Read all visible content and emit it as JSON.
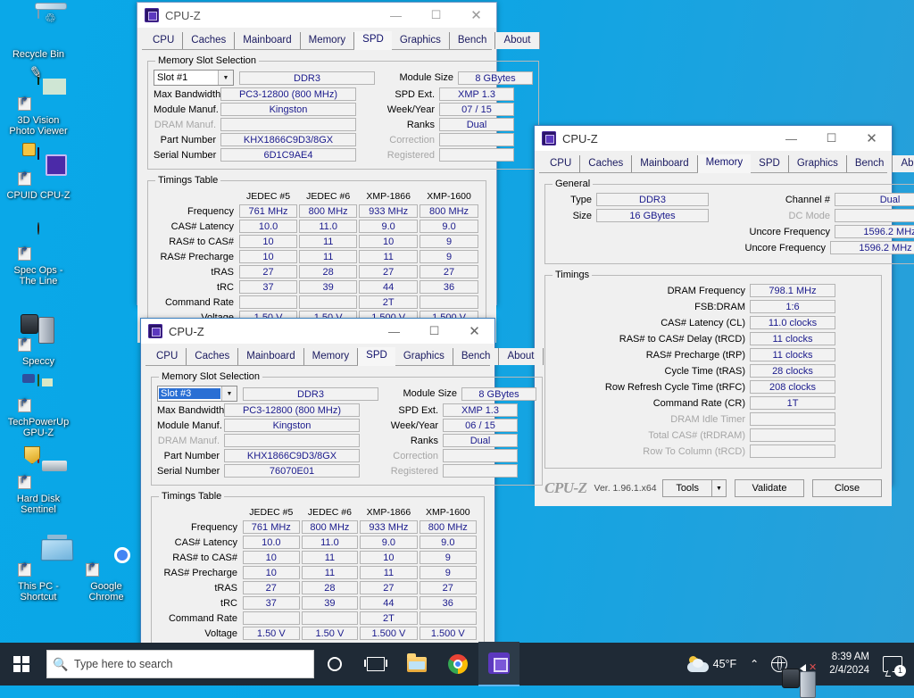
{
  "desktop": {
    "icons": [
      {
        "name": "recycle-bin",
        "label": "Recycle Bin"
      },
      {
        "name": "3d-vision-photo-viewer",
        "label": "3D Vision\nPhoto Viewer"
      },
      {
        "name": "cpuid-cpu-z",
        "label": "CPUID CPU-Z"
      },
      {
        "name": "spec-ops-the-line",
        "label": "Spec Ops -\nThe Line"
      },
      {
        "name": "speccy",
        "label": "Speccy"
      },
      {
        "name": "techpowerup-gpu-z",
        "label": "TechPowerUp\nGPU-Z"
      },
      {
        "name": "hard-disk-sentinel",
        "label": "Hard Disk\nSentinel"
      },
      {
        "name": "this-pc-shortcut",
        "label": "This PC -\nShortcut"
      },
      {
        "name": "google-chrome",
        "label": "Google\nChrome"
      }
    ]
  },
  "common": {
    "app_title": "CPU-Z",
    "tabs": [
      "CPU",
      "Caches",
      "Mainboard",
      "Memory",
      "SPD",
      "Graphics",
      "Bench",
      "About"
    ],
    "minimize": "—",
    "maximize": "☐",
    "close": "✕"
  },
  "spd_window_1": {
    "title": "CPU-Z",
    "selected_tab": "SPD",
    "slot_group_title": "Memory Slot Selection",
    "slot_selected": "Slot #1",
    "slot_focused": false,
    "memory_type": "DDR3",
    "left_fields": [
      {
        "label": "Max Bandwidth",
        "value": "PC3-12800 (800 MHz)",
        "dim": false
      },
      {
        "label": "Module Manuf.",
        "value": "Kingston",
        "dim": false
      },
      {
        "label": "DRAM Manuf.",
        "value": "",
        "dim": true
      },
      {
        "label": "Part Number",
        "value": "KHX1866C9D3/8GX",
        "dim": false
      },
      {
        "label": "Serial Number",
        "value": "6D1C9AE4",
        "dim": false
      }
    ],
    "right_fields": [
      {
        "label": "Module Size",
        "value": "8 GBytes",
        "dim": false
      },
      {
        "label": "SPD Ext.",
        "value": "XMP 1.3",
        "dim": false
      },
      {
        "label": "Week/Year",
        "value": "07 / 15",
        "dim": false
      },
      {
        "label": "Ranks",
        "value": "Dual",
        "dim": false
      },
      {
        "label": "Correction",
        "value": "",
        "dim": true
      },
      {
        "label": "Registered",
        "value": "",
        "dim": true
      }
    ],
    "timings_title": "Timings Table",
    "timings_columns": [
      "JEDEC #5",
      "JEDEC #6",
      "XMP-1866",
      "XMP-1600"
    ],
    "timings_rows": [
      {
        "label": "Frequency",
        "values": [
          "761 MHz",
          "800 MHz",
          "933 MHz",
          "800 MHz"
        ]
      },
      {
        "label": "CAS# Latency",
        "values": [
          "10.0",
          "11.0",
          "9.0",
          "9.0"
        ]
      },
      {
        "label": "RAS# to CAS#",
        "values": [
          "10",
          "11",
          "10",
          "9"
        ]
      },
      {
        "label": "RAS# Precharge",
        "values": [
          "10",
          "11",
          "11",
          "9"
        ]
      },
      {
        "label": "tRAS",
        "values": [
          "27",
          "28",
          "27",
          "27"
        ]
      },
      {
        "label": "tRC",
        "values": [
          "37",
          "39",
          "44",
          "36"
        ]
      },
      {
        "label": "Command Rate",
        "values": [
          "",
          "",
          "2T",
          ""
        ]
      },
      {
        "label": "Voltage",
        "values": [
          "1.50 V",
          "1.50 V",
          "1.500 V",
          "1.500 V"
        ]
      }
    ]
  },
  "spd_window_2": {
    "title": "CPU-Z",
    "selected_tab": "SPD",
    "slot_group_title": "Memory Slot Selection",
    "slot_selected": "Slot #3",
    "slot_focused": true,
    "memory_type": "DDR3",
    "left_fields": [
      {
        "label": "Max Bandwidth",
        "value": "PC3-12800 (800 MHz)",
        "dim": false
      },
      {
        "label": "Module Manuf.",
        "value": "Kingston",
        "dim": false
      },
      {
        "label": "DRAM Manuf.",
        "value": "",
        "dim": true
      },
      {
        "label": "Part Number",
        "value": "KHX1866C9D3/8GX",
        "dim": false
      },
      {
        "label": "Serial Number",
        "value": "76070E01",
        "dim": false
      }
    ],
    "right_fields": [
      {
        "label": "Module Size",
        "value": "8 GBytes",
        "dim": false
      },
      {
        "label": "SPD Ext.",
        "value": "XMP 1.3",
        "dim": false
      },
      {
        "label": "Week/Year",
        "value": "06 / 15",
        "dim": false
      },
      {
        "label": "Ranks",
        "value": "Dual",
        "dim": false
      },
      {
        "label": "Correction",
        "value": "",
        "dim": true
      },
      {
        "label": "Registered",
        "value": "",
        "dim": true
      }
    ],
    "timings_title": "Timings Table",
    "timings_columns": [
      "JEDEC #5",
      "JEDEC #6",
      "XMP-1866",
      "XMP-1600"
    ],
    "timings_rows": [
      {
        "label": "Frequency",
        "values": [
          "761 MHz",
          "800 MHz",
          "933 MHz",
          "800 MHz"
        ]
      },
      {
        "label": "CAS# Latency",
        "values": [
          "10.0",
          "11.0",
          "9.0",
          "9.0"
        ]
      },
      {
        "label": "RAS# to CAS#",
        "values": [
          "10",
          "11",
          "10",
          "9"
        ]
      },
      {
        "label": "RAS# Precharge",
        "values": [
          "10",
          "11",
          "11",
          "9"
        ]
      },
      {
        "label": "tRAS",
        "values": [
          "27",
          "28",
          "27",
          "27"
        ]
      },
      {
        "label": "tRC",
        "values": [
          "37",
          "39",
          "44",
          "36"
        ]
      },
      {
        "label": "Command Rate",
        "values": [
          "",
          "",
          "2T",
          ""
        ]
      },
      {
        "label": "Voltage",
        "values": [
          "1.50 V",
          "1.50 V",
          "1.500 V",
          "1.500 V"
        ]
      }
    ]
  },
  "memory_window": {
    "title": "CPU-Z",
    "selected_tab": "Memory",
    "general_title": "General",
    "general_left": [
      {
        "label": "Type",
        "value": "DDR3",
        "dim": false
      },
      {
        "label": "Size",
        "value": "16 GBytes",
        "dim": false
      }
    ],
    "general_right": [
      {
        "label": "Channel #",
        "value": "Dual",
        "dim": false
      },
      {
        "label": "DC Mode",
        "value": "",
        "dim": true
      },
      {
        "label": "Uncore Frequency",
        "value": "1596.2 MHz",
        "dim": false
      }
    ],
    "timings_title": "Timings",
    "timings": [
      {
        "label": "DRAM Frequency",
        "value": "798.1 MHz",
        "dim": false
      },
      {
        "label": "FSB:DRAM",
        "value": "1:6",
        "dim": false
      },
      {
        "label": "CAS# Latency (CL)",
        "value": "11.0 clocks",
        "dim": false
      },
      {
        "label": "RAS# to CAS# Delay (tRCD)",
        "value": "11 clocks",
        "dim": false
      },
      {
        "label": "RAS# Precharge (tRP)",
        "value": "11 clocks",
        "dim": false
      },
      {
        "label": "Cycle Time (tRAS)",
        "value": "28 clocks",
        "dim": false
      },
      {
        "label": "Row Refresh Cycle Time (tRFC)",
        "value": "208 clocks",
        "dim": false
      },
      {
        "label": "Command Rate (CR)",
        "value": "1T",
        "dim": false
      },
      {
        "label": "DRAM Idle Timer",
        "value": "",
        "dim": true
      },
      {
        "label": "Total CAS# (tRDRAM)",
        "value": "",
        "dim": true
      },
      {
        "label": "Row To Column (tRCD)",
        "value": "",
        "dim": true
      }
    ],
    "footer": {
      "logo": "CPU-Z",
      "version": "Ver. 1.96.1.x64",
      "tools_label": "Tools",
      "validate_label": "Validate",
      "close_label": "Close"
    }
  },
  "taskbar": {
    "start": "start-button",
    "search_placeholder": "Type here to search",
    "weather_temp": "45°F",
    "clock_time": "8:39 AM",
    "clock_date": "2/4/2024",
    "notification_count": "1"
  }
}
